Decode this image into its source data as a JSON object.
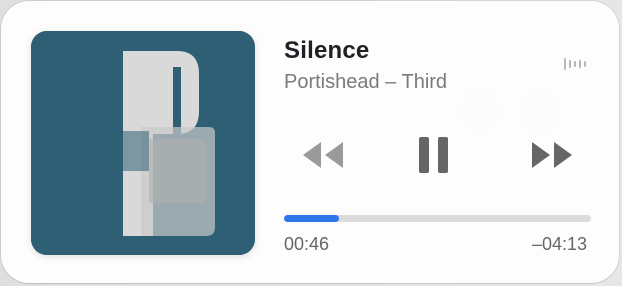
{
  "track": {
    "title": "Silence",
    "subtitle": "Portishead – Third"
  },
  "album_art": {
    "name": "album-art",
    "letter_text": "P"
  },
  "controls": {
    "rewind_icon": "rewind-icon",
    "pause_icon": "pause-icon",
    "forward_icon": "fast-forward-icon"
  },
  "status_icon": "audio-output-icon",
  "progress": {
    "fraction": 0.18,
    "elapsed": "00:46",
    "remaining": "–04:13"
  },
  "colors": {
    "accent": "#2f76ea",
    "art_bg": "#2f5f75",
    "art_light": "#d9d9d9"
  }
}
